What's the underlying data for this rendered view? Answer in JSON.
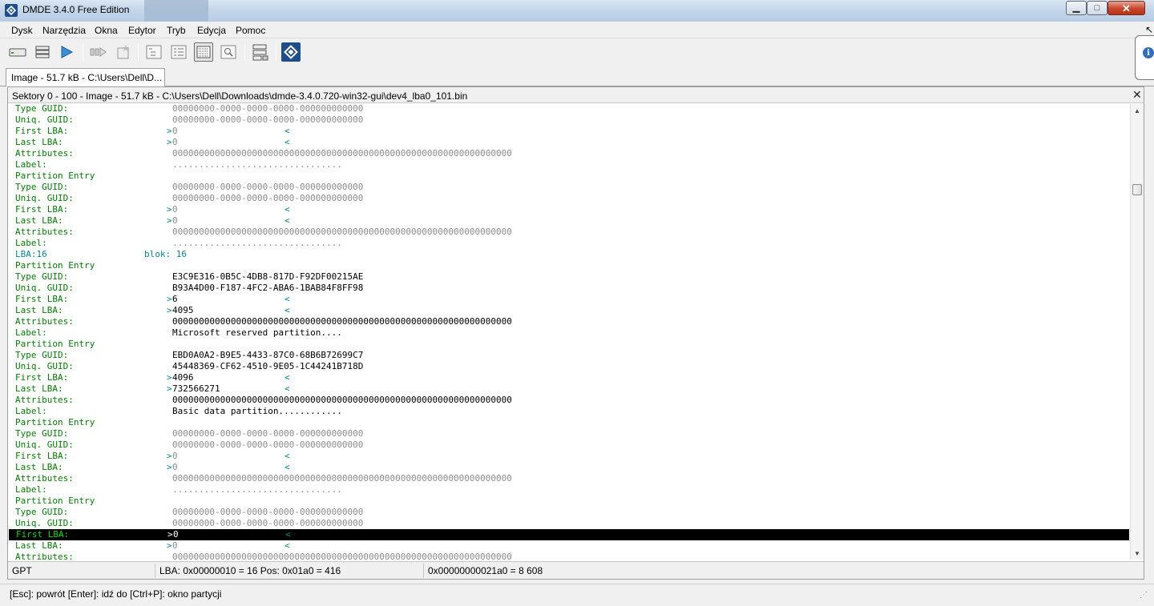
{
  "window": {
    "title": "DMDE 3.4.0 Free Edition",
    "controls": {
      "minimize": "▁",
      "maximize": "□",
      "close": "✕"
    }
  },
  "menu": [
    "Dysk",
    "Narzędzia",
    "Okna",
    "Edytor",
    "Tryb",
    "Edycja",
    "Pomoc"
  ],
  "toolbar": {
    "icons": [
      "drive-icon",
      "list-icon",
      "play-icon",
      "step-icon",
      "gear-star-icon",
      "tree-view-icon",
      "list-view-icon",
      "sector-view-icon",
      "search-view-icon",
      "partitions-icon",
      "dmde-logo-icon"
    ],
    "pressed": "sector-view-icon"
  },
  "tab": {
    "label": "Image - 51.7 kB - C:\\Users\\Dell\\D..."
  },
  "panel": {
    "title": "Sektory 0 - 100 - Image - 51.7 kB - C:\\Users\\Dell\\Downloads\\dmde-3.4.0.720-win32-gui\\dev4_lba0_101.bin",
    "close": "✕",
    "lines": [
      {
        "label": "Type GUID:",
        "value": "00000000-0000-0000-0000-000000000000",
        "style": "gray"
      },
      {
        "label": "Uniq. GUID:",
        "value": "00000000-0000-0000-0000-000000000000",
        "style": "gray"
      },
      {
        "label": "First LBA:",
        "value": "0",
        "style": "gray",
        "lba": true
      },
      {
        "label": "Last LBA:",
        "value": "0",
        "style": "gray",
        "lba": true
      },
      {
        "label": "Attributes:",
        "value": "0000000000000000000000000000000000000000000000000000000000000000",
        "style": "gray"
      },
      {
        "label": "Label:",
        "value": "................................",
        "style": "gray"
      },
      {
        "label": "Partition Entry",
        "value": "",
        "style": "gray"
      },
      {
        "label": "Type GUID:",
        "value": "00000000-0000-0000-0000-000000000000",
        "style": "gray"
      },
      {
        "label": "Uniq. GUID:",
        "value": "00000000-0000-0000-0000-000000000000",
        "style": "gray"
      },
      {
        "label": "First LBA:",
        "value": "0",
        "style": "gray",
        "lba": true
      },
      {
        "label": "Last LBA:",
        "value": "0",
        "style": "gray",
        "lba": true
      },
      {
        "label": "Attributes:",
        "value": "0000000000000000000000000000000000000000000000000000000000000000",
        "style": "gray"
      },
      {
        "label": "Label:",
        "value": "................................",
        "style": "gray"
      },
      {
        "label": "LBA:16",
        "blok": "blok: 16",
        "value": "",
        "style": "lba"
      },
      {
        "label": "Partition Entry",
        "value": "",
        "style": "black"
      },
      {
        "label": "Type GUID:",
        "value": "E3C9E316-0B5C-4DB8-817D-F92DF00215AE",
        "style": "black"
      },
      {
        "label": "Uniq. GUID:",
        "value": "B93A4D00-F187-4FC2-ABA6-1BAB84F8FF98",
        "style": "black"
      },
      {
        "label": "First LBA:",
        "value": "6",
        "style": "black",
        "lba": true
      },
      {
        "label": "Last LBA:",
        "value": "4095",
        "style": "black",
        "lba": true
      },
      {
        "label": "Attributes:",
        "value": "0000000000000000000000000000000000000000000000000000000000000000",
        "style": "black"
      },
      {
        "label": "Label:",
        "value": "Microsoft reserved partition....",
        "style": "black"
      },
      {
        "label": "Partition Entry",
        "value": "",
        "style": "black"
      },
      {
        "label": "Type GUID:",
        "value": "EBD0A0A2-B9E5-4433-87C0-68B6B72699C7",
        "style": "black"
      },
      {
        "label": "Uniq. GUID:",
        "value": "45448369-CF62-4510-9E05-1C44241B718D",
        "style": "black"
      },
      {
        "label": "First LBA:",
        "value": "4096",
        "style": "black",
        "lba": true
      },
      {
        "label": "Last LBA:",
        "value": "732566271",
        "style": "black",
        "lba": true
      },
      {
        "label": "Attributes:",
        "value": "0000000000000000000000000000000000000000000000000000000000000000",
        "style": "black"
      },
      {
        "label": "Label:",
        "value": "Basic data partition............",
        "style": "black"
      },
      {
        "label": "Partition Entry",
        "value": "",
        "style": "gray"
      },
      {
        "label": "Type GUID:",
        "value": "00000000-0000-0000-0000-000000000000",
        "style": "gray"
      },
      {
        "label": "Uniq. GUID:",
        "value": "00000000-0000-0000-0000-000000000000",
        "style": "gray"
      },
      {
        "label": "First LBA:",
        "value": "0",
        "style": "gray",
        "lba": true
      },
      {
        "label": "Last LBA:",
        "value": "0",
        "style": "gray",
        "lba": true
      },
      {
        "label": "Attributes:",
        "value": "0000000000000000000000000000000000000000000000000000000000000000",
        "style": "gray"
      },
      {
        "label": "Label:",
        "value": "................................",
        "style": "gray"
      },
      {
        "label": "Partition Entry",
        "value": "",
        "style": "gray"
      },
      {
        "label": "Type GUID:",
        "value": "00000000-0000-0000-0000-000000000000",
        "style": "gray"
      },
      {
        "label": "Uniq. GUID:",
        "value": "00000000-0000-0000-0000-000000000000",
        "style": "gray"
      },
      {
        "label": "First LBA:",
        "value": "0",
        "style": "gray",
        "lba": true,
        "selected": true
      },
      {
        "label": "Last LBA:",
        "value": "0",
        "style": "gray",
        "lba": true
      },
      {
        "label": "Attributes:",
        "value": "0000000000000000000000000000000000000000000000000000000000000000",
        "style": "gray"
      }
    ],
    "status": {
      "mode": "GPT",
      "position": "LBA: 0x00000010 = 16  Pos: 0x01a0 = 416",
      "offset": "0x00000000021a0 = 8 608"
    }
  },
  "statusbar": {
    "text": "[Esc]: powrót  [Enter]: idź do  [Ctrl+P]: okno partycji"
  },
  "colors": {
    "label_green": "#008000",
    "lba_cyan": "#008b8b",
    "value_gray": "#8c8c8c"
  }
}
